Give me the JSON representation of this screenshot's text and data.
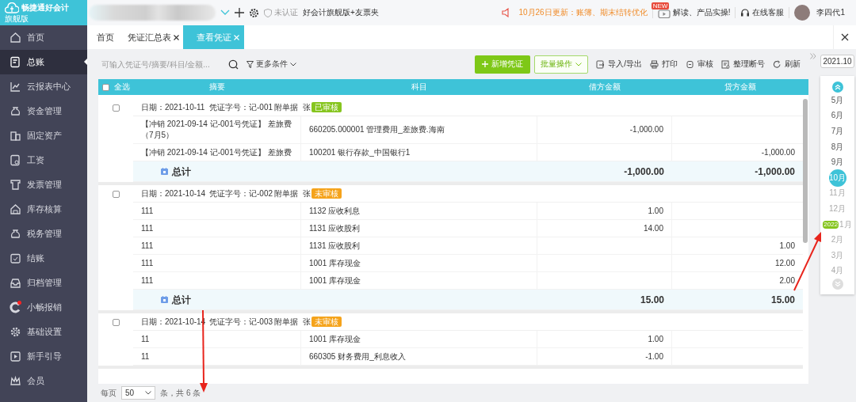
{
  "app": {
    "name": "畅捷通好会计",
    "edition": "旗舰版"
  },
  "topbar": {
    "certification": "未认证",
    "product": "好会计旗舰版+友票夹",
    "notice": "10月26日更新：账簿、期末结转优化",
    "promo_badge": "NEW",
    "promo": "解读、产品实操!",
    "support": "在线客服",
    "user": "李四代1"
  },
  "sidebar": {
    "items": [
      {
        "label": "首页",
        "selected": false,
        "notify": false
      },
      {
        "label": "总账",
        "selected": true,
        "notify": false
      },
      {
        "label": "云报表中心",
        "selected": false,
        "notify": false
      },
      {
        "label": "资金管理",
        "selected": false,
        "notify": false
      },
      {
        "label": "固定资产",
        "selected": false,
        "notify": false
      },
      {
        "label": "工资",
        "selected": false,
        "notify": false
      },
      {
        "label": "发票管理",
        "selected": false,
        "notify": false
      },
      {
        "label": "库存核算",
        "selected": false,
        "notify": false
      },
      {
        "label": "税务管理",
        "selected": false,
        "notify": false
      },
      {
        "label": "结账",
        "selected": false,
        "notify": false
      },
      {
        "label": "归档管理",
        "selected": false,
        "notify": false
      },
      {
        "label": "小畅报销",
        "selected": false,
        "notify": true
      },
      {
        "label": "基础设置",
        "selected": false,
        "notify": false
      },
      {
        "label": "新手引导",
        "selected": false,
        "notify": false
      },
      {
        "label": "会员",
        "selected": false,
        "notify": false
      }
    ]
  },
  "tabs": [
    {
      "label": "首页",
      "selected": false,
      "closable": false
    },
    {
      "label": "凭证汇总表",
      "selected": false,
      "closable": true
    },
    {
      "label": "查看凭证",
      "selected": true,
      "closable": true
    }
  ],
  "toolbar": {
    "search_placeholder": "可输入凭证号/摘要/科目/金额...",
    "more_filters": "更多条件",
    "buttons": [
      {
        "label": "新增凭证",
        "kind": "primary"
      },
      {
        "label": "批量操作",
        "kind": "dropdown"
      },
      {
        "label": "导入/导出",
        "kind": "plain"
      },
      {
        "label": "打印",
        "kind": "plain"
      },
      {
        "label": "审核",
        "kind": "plain"
      },
      {
        "label": "整理断号",
        "kind": "plain"
      },
      {
        "label": "刷新",
        "kind": "plain"
      }
    ]
  },
  "table": {
    "select_all": {
      "label": "全选",
      "checked": false
    },
    "columns": [
      "摘要",
      "科目",
      "借方金额",
      "贷方金额"
    ],
    "vouchers": [
      {
        "checked": false,
        "date": "日期：2021-10-11",
        "number": "凭证字号：记-001",
        "attachments": "附单据",
        "attachments_unit": "张",
        "status": {
          "label": "已审核",
          "color": "#86c51f"
        },
        "entries": [
          {
            "summary": "【冲销 2021-09-14 记-001号凭证】 差旅费（7月5）",
            "account": "660205.000001  管理费用_差旅费.海南",
            "debit": "-1,000.00"
          },
          {
            "summary": "【冲销 2021-09-14 记-001号凭证】 差旅费",
            "account": "100201 银行存款_中国银行1",
            "credit": "-1,000.00"
          }
        ],
        "total": {
          "label": "总计",
          "debit": "-1,000.00",
          "credit": "-1,000.00"
        }
      },
      {
        "checked": false,
        "date": "日期：2021-10-14",
        "number": "凭证字号：记-002",
        "attachments": "附单据",
        "attachments_unit": "张",
        "status": {
          "label": "未审核",
          "color": "#f5a31b"
        },
        "entries": [
          {
            "summary": "111",
            "account": "1132 应收利息",
            "debit": "1.00"
          },
          {
            "summary": "111",
            "account": "1131 应收股利",
            "debit": "14.00"
          },
          {
            "summary": "111",
            "account": "1131 应收股利",
            "credit": "1.00"
          },
          {
            "summary": "111",
            "account": "1001 库存现金",
            "credit": "12.00"
          },
          {
            "summary": "111",
            "account": "1001 库存现金",
            "credit": "2.00"
          }
        ],
        "total": {
          "label": "总计",
          "debit": "15.00",
          "credit": "15.00"
        }
      },
      {
        "checked": false,
        "date": "日期：2021-10-14",
        "number": "凭证字号：记-003",
        "attachments": "附单据",
        "attachments_unit": "张",
        "status": {
          "label": "未审核",
          "color": "#f5a31b"
        },
        "entries": [
          {
            "summary": "11",
            "account": "1001 库存现金",
            "debit": "1.00"
          },
          {
            "summary": "11",
            "account": "660305 财务费用_利息收入",
            "debit": "-1.00"
          }
        ]
      }
    ]
  },
  "pagination": {
    "per_page_label": "每页",
    "per_page": "50",
    "total_text": "条，共 6 条"
  },
  "periods": {
    "current": "2021.10",
    "months": [
      {
        "label": "5月",
        "selected": false,
        "disabled": false
      },
      {
        "label": "6月",
        "selected": false,
        "disabled": false
      },
      {
        "label": "7月",
        "selected": false,
        "disabled": false
      },
      {
        "label": "8月",
        "selected": false,
        "disabled": false
      },
      {
        "label": "9月",
        "selected": false,
        "disabled": false
      },
      {
        "label": "10月",
        "selected": true,
        "disabled": false
      },
      {
        "label": "11月",
        "selected": false,
        "disabled": true
      },
      {
        "label": "12月",
        "selected": false,
        "disabled": true
      },
      {
        "label": "1月",
        "selected": false,
        "disabled": true,
        "year_tag": "2022"
      },
      {
        "label": "2月",
        "selected": false,
        "disabled": true
      },
      {
        "label": "3月",
        "selected": false,
        "disabled": true
      },
      {
        "label": "4月",
        "selected": false,
        "disabled": true
      }
    ]
  }
}
